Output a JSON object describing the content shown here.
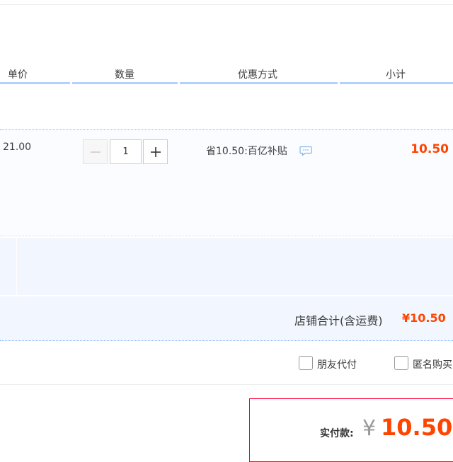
{
  "table_header": {
    "unit_price": "单价",
    "quantity": "数量",
    "discount_method": "优惠方式",
    "subtotal": "小计"
  },
  "item": {
    "unit_price": "21.00",
    "quantity": "1",
    "promo_text": "省10.50:百亿补贴",
    "subtotal": "10.50"
  },
  "shop_total": {
    "label": "店铺合计(含运费)",
    "value": "¥10.50"
  },
  "options": [
    {
      "label": "朋友代付"
    },
    {
      "label": "匿名购买"
    }
  ],
  "payment": {
    "label": "实付款:",
    "currency": "¥",
    "amount": "10.50"
  },
  "colors": {
    "accent_orange": "#ff4400",
    "header_bar_blue": "#b2d1ff",
    "row_bg_blue": "#f2f7ff",
    "pay_border_red": "#ff0036"
  }
}
